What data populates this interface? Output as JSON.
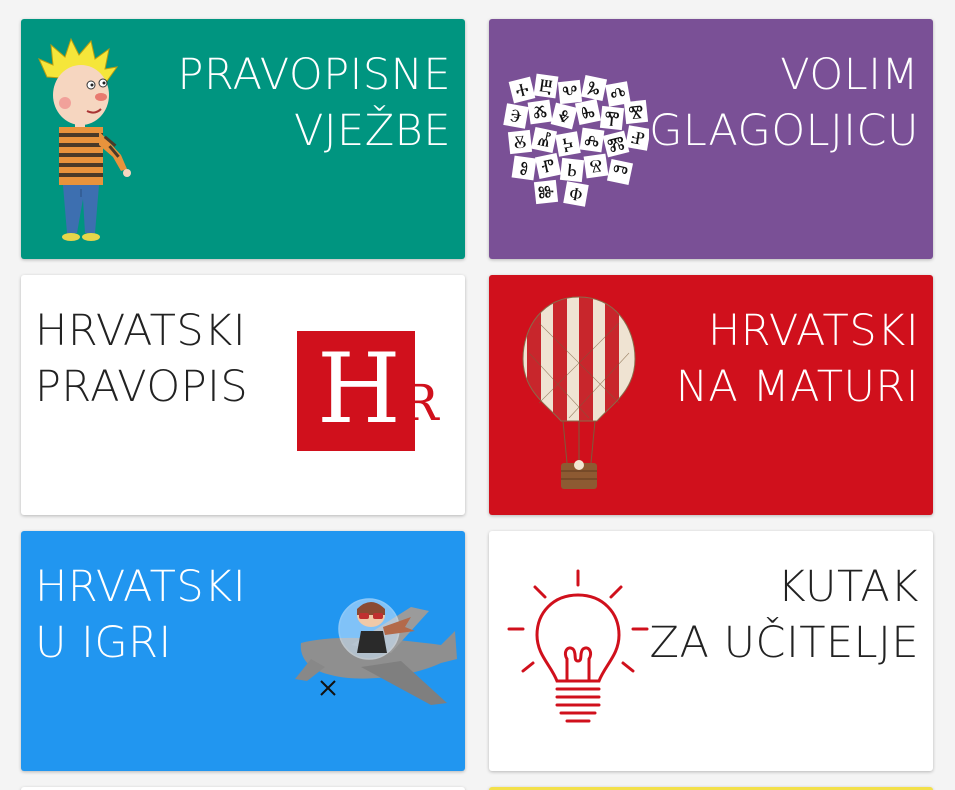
{
  "cards": [
    {
      "id": "pravopisne-vjezbe",
      "lines": [
        "PRAVOPISNE",
        "VJEŽBE"
      ],
      "bg": "#009580"
    },
    {
      "id": "volim-glagoljicu",
      "lines": [
        "VOLIM",
        "GLAGOLJICU"
      ],
      "bg": "#7a5096"
    },
    {
      "id": "hrvatski-pravopis",
      "lines": [
        "HRVATSKI",
        "PRAVOPIS"
      ],
      "bg": "#ffffff",
      "logo": {
        "big": "H",
        "small": "R",
        "bg": "#d0101c"
      }
    },
    {
      "id": "hrvatski-na-maturi",
      "lines": [
        "HRVATSKI",
        "NA MATURI"
      ],
      "bg": "#d0101c"
    },
    {
      "id": "hrvatski-u-igri",
      "lines": [
        "HRVATSKI",
        "U IGRI"
      ],
      "bg": "#2196f0"
    },
    {
      "id": "kutak-za-ucitelje",
      "lines": [
        "KUTAK",
        "ZA UČITELJE"
      ],
      "bg": "#ffffff"
    }
  ],
  "glagolitic": [
    "Ⰰ",
    "Ⰱ",
    "Ⰲ",
    "Ⰳ",
    "Ⰴ",
    "Ⰵ",
    "Ⰶ",
    "Ⰷ",
    "Ⰸ",
    "Ⰹ",
    "Ⰺ",
    "Ⰻ",
    "Ⰼ",
    "Ⰽ",
    "Ⰾ",
    "Ⰿ",
    "Ⱀ",
    "Ⱁ",
    "Ⱂ",
    "Ⱃ",
    "Ⱄ",
    "Ⱅ",
    "Ⱆ",
    "Ⱇ"
  ],
  "colors": {
    "accent_red": "#d0101c",
    "teal": "#009580",
    "purple": "#7a5096",
    "blue": "#2196f0",
    "yellow_strip": "#f3e04a"
  }
}
